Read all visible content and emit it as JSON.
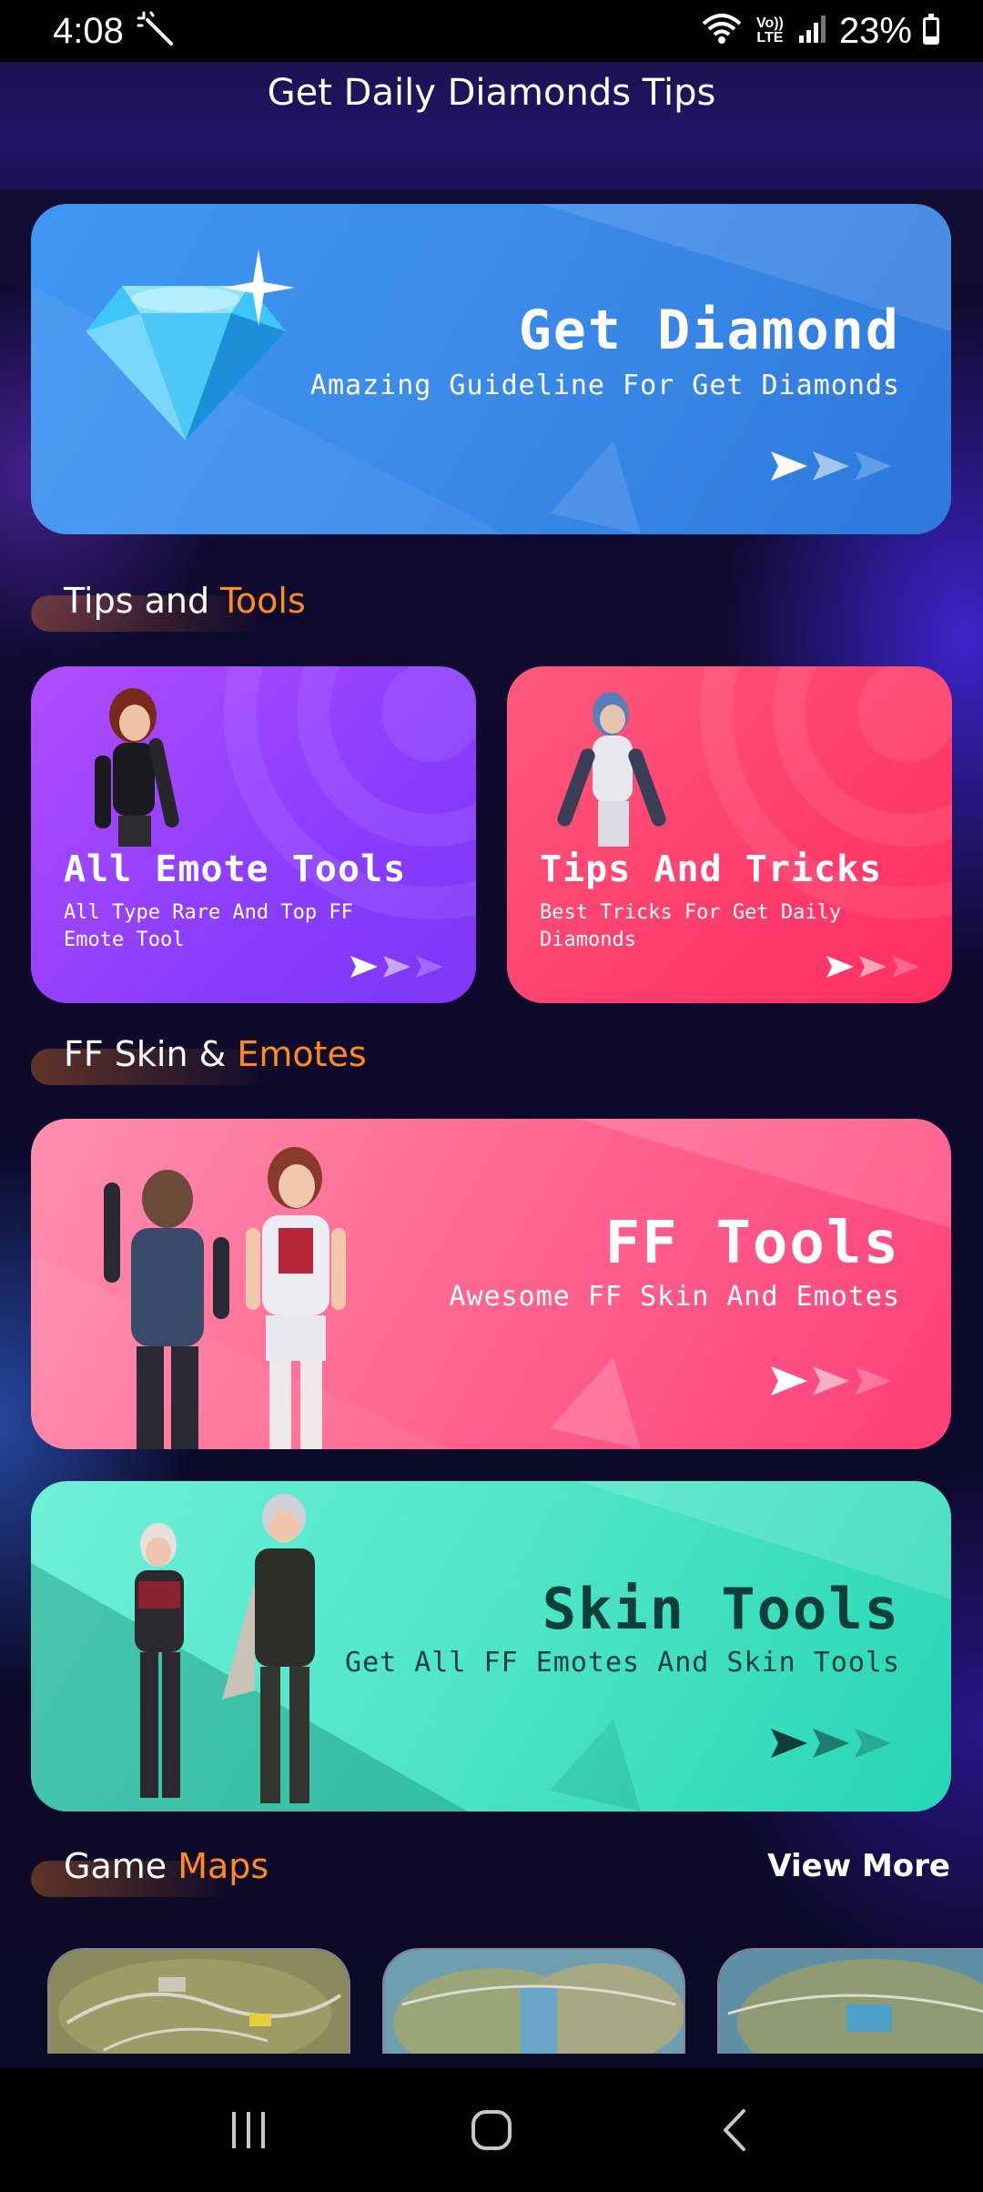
{
  "status_bar": {
    "time": "4:08",
    "battery_pct": "23%",
    "battery_level": 0.23,
    "icons": [
      "magic-wand-icon",
      "wifi-icon",
      "volte-icon",
      "signal-icon",
      "battery-icon"
    ],
    "volte_label": "Vo)) LTE"
  },
  "header": {
    "title": "Get Daily Diamonds Tips"
  },
  "hero_card": {
    "title": "Get Diamond",
    "subtitle": "Amazing Guideline For Get Diamonds",
    "color": "#3b8ae9"
  },
  "section_tips": {
    "label_a": "Tips and ",
    "label_b": "Tools"
  },
  "tips_cards": [
    {
      "title": "All Emote Tools",
      "subtitle_line1": "All Type Rare And Top FF",
      "subtitle_line2": "Emote Tool",
      "color": "#8b3dff"
    },
    {
      "title": "Tips And Tricks",
      "subtitle_line1": "Best Tricks For Get Daily",
      "subtitle_line2": "Diamonds",
      "color": "#ff3d6c"
    }
  ],
  "section_ff": {
    "label_a": "FF Skin & ",
    "label_b": "Emotes"
  },
  "ff_card": {
    "title": "FF Tools",
    "subtitle": "Awesome FF Skin And Emotes",
    "color": "#ff6d96"
  },
  "skin_card": {
    "title": "Skin Tools",
    "subtitle": "Get All FF Emotes And Skin Tools",
    "color": "#4ee5c6"
  },
  "section_maps": {
    "label_a": "Game ",
    "label_b": "Maps",
    "view_more": "View More"
  },
  "maps": [
    {
      "name": "map-bermuda"
    },
    {
      "name": "map-purgatory"
    },
    {
      "name": "map-kalahari"
    }
  ],
  "accent_color": "#ff8a1f",
  "nav_bar": {
    "buttons": [
      "recents-icon",
      "home-icon",
      "back-icon"
    ]
  }
}
